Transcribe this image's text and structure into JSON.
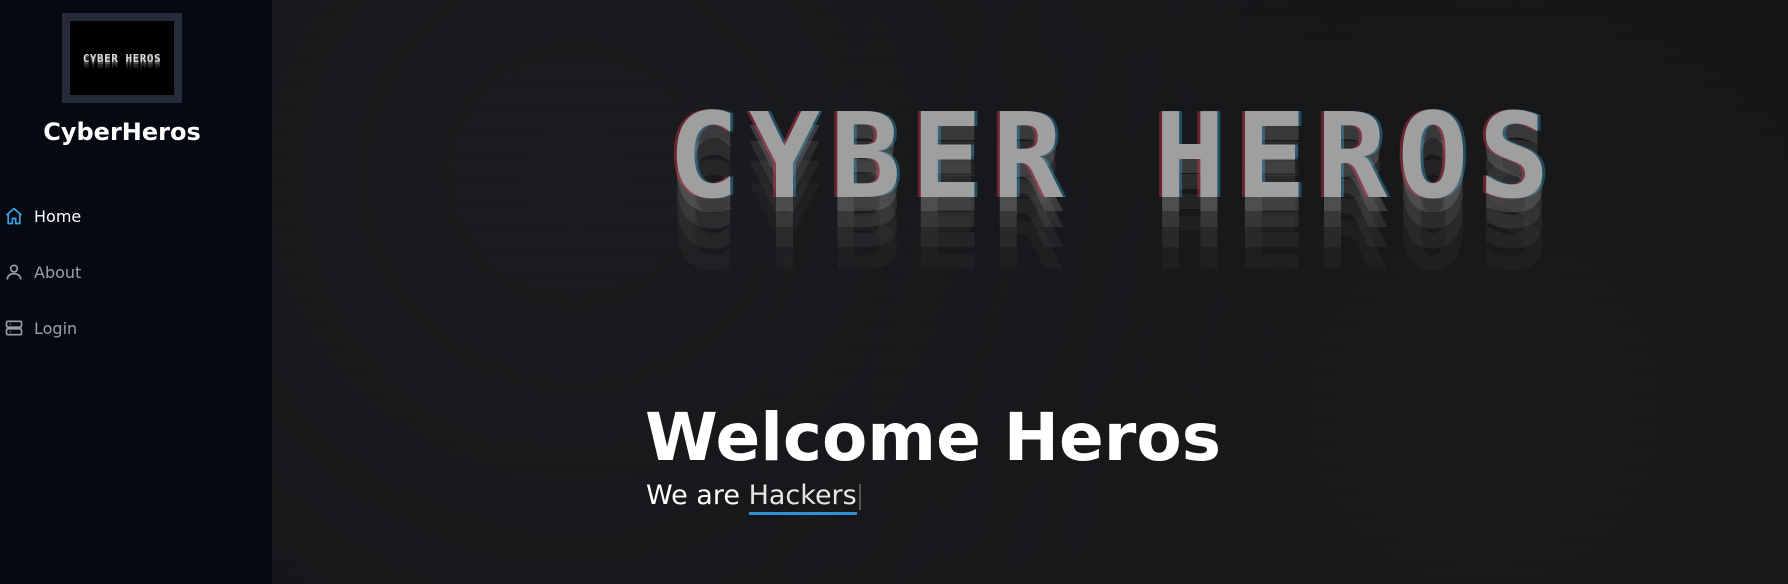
{
  "sidebar": {
    "logo_text": "CYBER HEROS",
    "brand": "CyberHeros",
    "items": [
      {
        "label": "Home",
        "icon": "home-icon",
        "active": true
      },
      {
        "label": "About",
        "icon": "user-icon",
        "active": false
      },
      {
        "label": "Login",
        "icon": "server-icon",
        "active": false
      }
    ]
  },
  "main": {
    "banner_text": "CYBER HEROS",
    "title": "Welcome Heros",
    "tagline_prefix": "We are",
    "tagline_typed": "Hackers"
  },
  "colors": {
    "sidebar_bg": "#050912",
    "main_bg": "#111214",
    "accent": "#2e8fd3",
    "active_icon": "#3fa0e0"
  }
}
